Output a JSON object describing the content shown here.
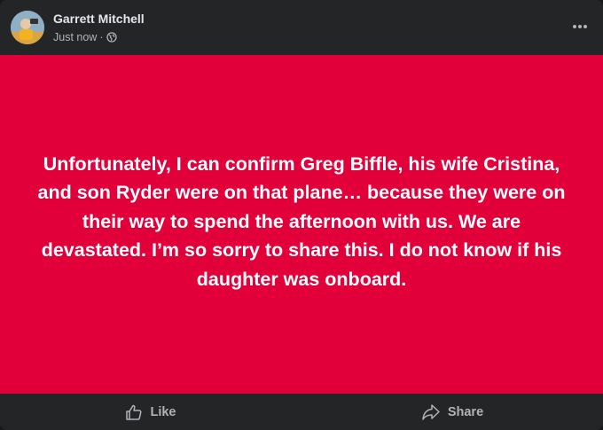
{
  "post": {
    "author": "Garrett Mitchell",
    "timestamp": "Just now",
    "separator": "·",
    "privacy_icon": "globe-icon",
    "more_icon": "more-dots-icon",
    "text": "Unfortunately, I can confirm Greg Biffle, his wife Cristina, and son Ryder were on that plane… because they were on their way to spend the afternoon with us. We are devastated. I’m so sorry to share this. I do not know if his daughter was onboard.",
    "background_color": "#e2003b"
  },
  "actions": {
    "like_label": "Like",
    "share_label": "Share"
  }
}
